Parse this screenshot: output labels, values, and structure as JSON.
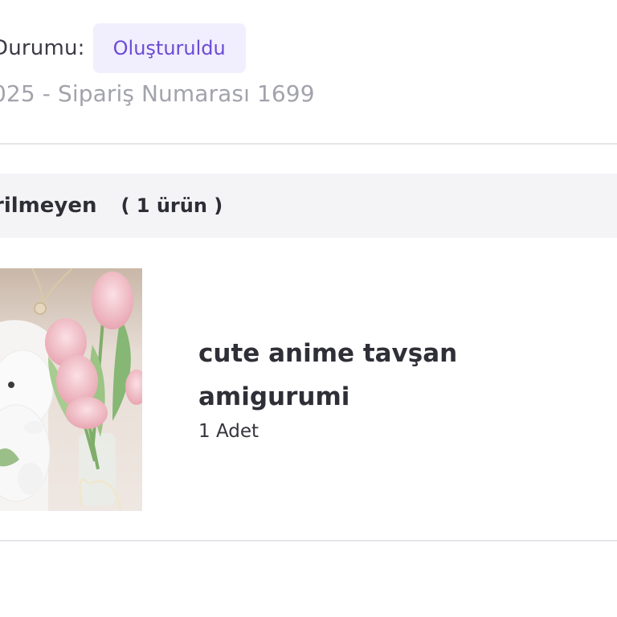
{
  "order": {
    "status_label": "Durumu:",
    "status_value": "Oluşturuldu",
    "meta_line": "025 - Sipariş Numarası 1699"
  },
  "section": {
    "title": "rilmeyen",
    "count": "( 1 ürün )"
  },
  "product": {
    "name": "cute anime tavşan amigurumi",
    "quantity": "1 Adet"
  },
  "colors": {
    "badge_background": "#f1eefd",
    "badge_text": "#6a4bd6",
    "section_background": "#f4f4f7",
    "divider": "#e6e6ea",
    "muted_text": "#a2a3ab"
  }
}
